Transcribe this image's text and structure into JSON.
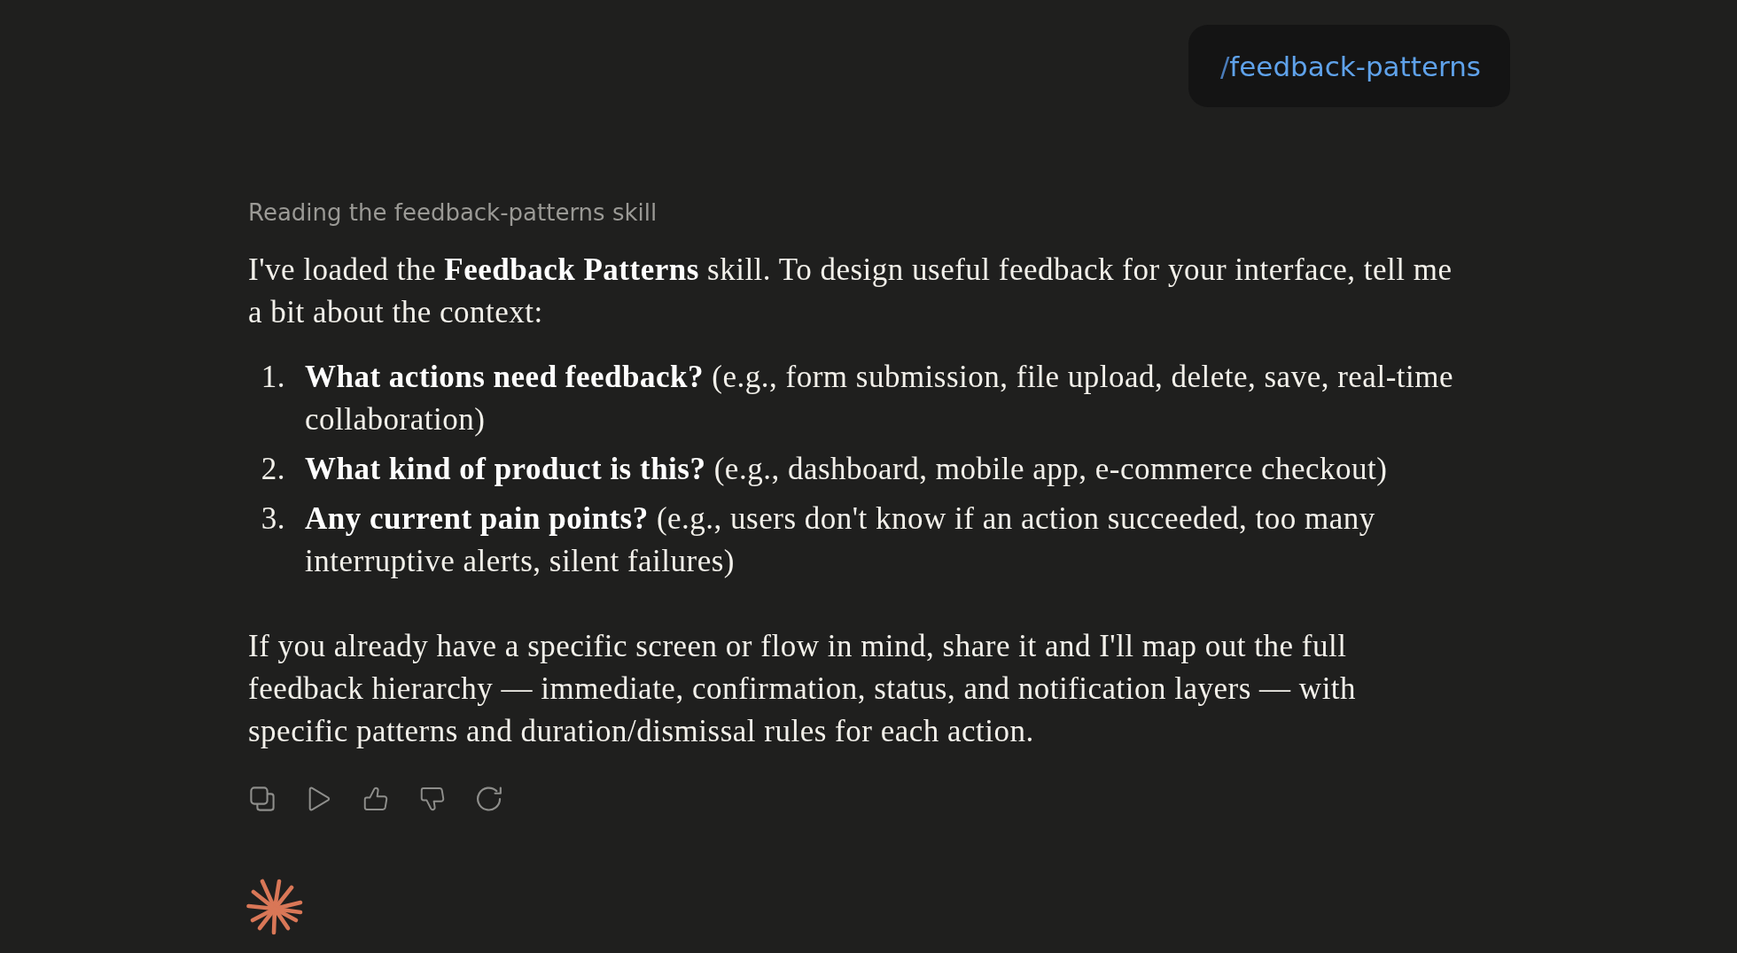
{
  "user_message": {
    "prefix": "/",
    "command": "feedback-patterns"
  },
  "assistant_message": {
    "status": "Reading the feedback-patterns skill",
    "intro": "I've loaded the **Feedback Patterns** skill. To design useful feedback for your interface, tell me a bit about the context:",
    "questions": [
      {
        "number": "1.",
        "text": "**What actions need feedback?** (e.g., form submission, file upload, delete, save, real-time collaboration)"
      },
      {
        "number": "2.",
        "text": "**What kind of product is this?** (e.g., dashboard, mobile app, e-commerce checkout)"
      },
      {
        "number": "3.",
        "text": "**Any current pain points?** (e.g., users don't know if an action succeeded, too many interruptive alerts, silent failures)"
      }
    ],
    "closing": "If you already have a specific screen or flow in mind, share it and I'll map out the full feedback hierarchy — immediate, confirmation, status, and notification layers — with specific patterns and duration/dismissal rules for each action."
  }
}
